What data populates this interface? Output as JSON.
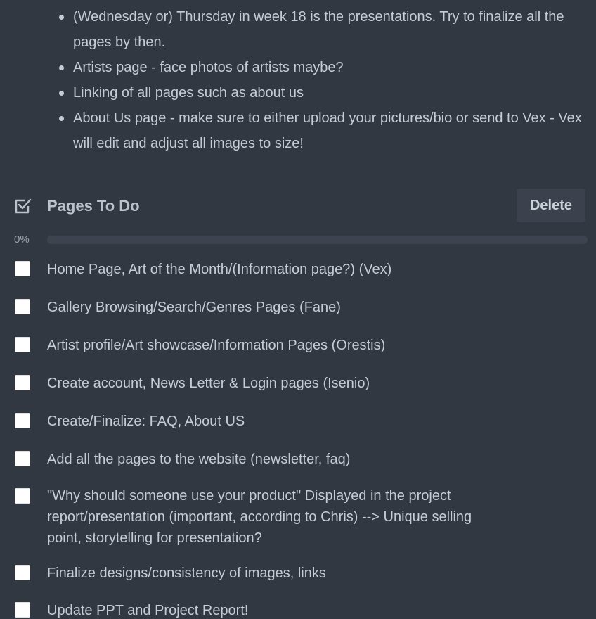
{
  "notes": {
    "bullets": [
      "(Wednesday or) Thursday in week 18 is the presentations. Try to finalize all the pages by then.",
      "Artists page - face photos of artists maybe?",
      "Linking of all pages such as about us",
      "About Us page - make sure to either upload your pictures/bio or send to Vex - Vex will edit and adjust all images to size!"
    ]
  },
  "checklist": {
    "icon": "checkbox-checked-icon",
    "title": "Pages To Do",
    "delete_label": "Delete",
    "progress_label": "0%",
    "progress_value": 0,
    "items": [
      {
        "text": "Home Page, Art of the Month/(Information page?) (Vex)",
        "checked": false
      },
      {
        "text": "Gallery Browsing/Search/Genres Pages (Fane)",
        "checked": false
      },
      {
        "text": "Artist profile/Art showcase/Information Pages (Orestis)",
        "checked": false
      },
      {
        "text": "Create account, News Letter & Login pages (Isenio)",
        "checked": false
      },
      {
        "text": "Create/Finalize: FAQ, About US",
        "checked": false
      },
      {
        "text": "Add all the pages to the website (newsletter, faq)",
        "checked": false
      },
      {
        "text": "\"Why should someone use your product\" Displayed in the project report/presentation (important, according to Chris) --> Unique selling point, storytelling for presentation?",
        "checked": false
      },
      {
        "text": "Finalize designs/consistency of images, links",
        "checked": false
      },
      {
        "text": "Update PPT and Project Report!",
        "checked": false
      }
    ]
  },
  "colors": {
    "background": "#323842",
    "text": "#c5ccd3",
    "button_bg": "#3b424d"
  }
}
